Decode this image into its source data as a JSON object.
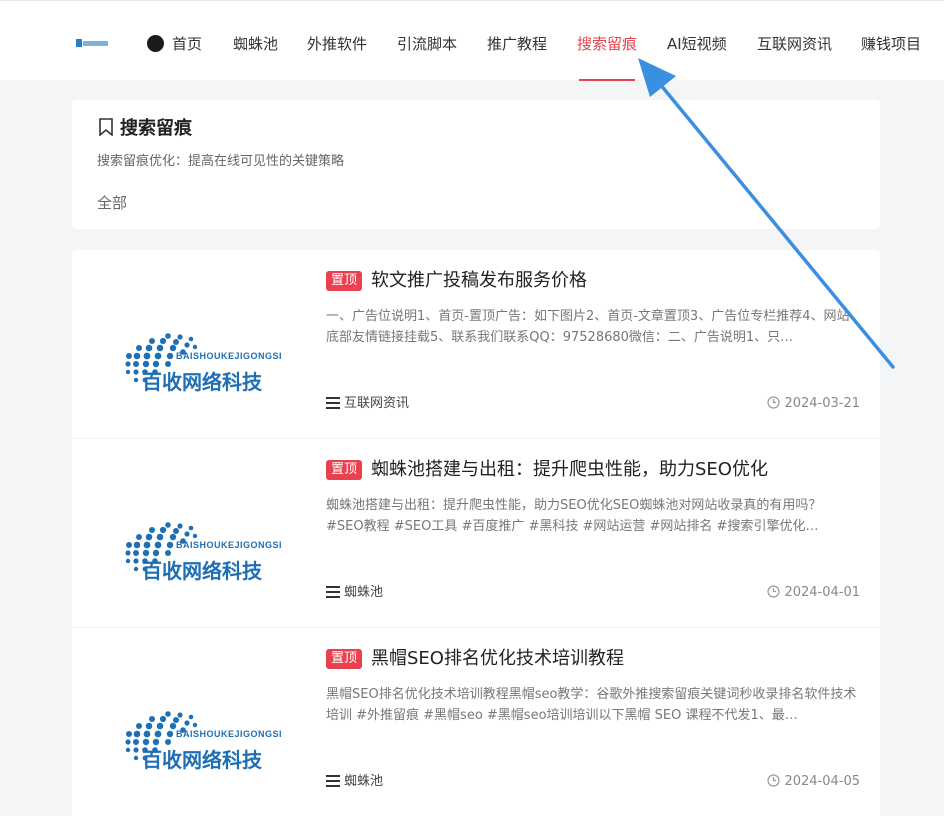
{
  "header": {
    "nav": [
      {
        "label": "首页"
      },
      {
        "label": "蜘蛛池"
      },
      {
        "label": "外推软件"
      },
      {
        "label": "引流脚本"
      },
      {
        "label": "推广教程"
      },
      {
        "label": "搜索留痕"
      },
      {
        "label": "AI短视频"
      },
      {
        "label": "互联网资讯"
      },
      {
        "label": "赚钱项目"
      }
    ],
    "active": "搜索留痕"
  },
  "category": {
    "title": "搜索留痕",
    "description": "搜索留痕优化：提高在线可见性的关键策略",
    "filter_all": "全部"
  },
  "thumbnail": {
    "brand_en": "BAISHOUKEJIGONGSI",
    "brand_cn": "百收网络科技"
  },
  "posts": [
    {
      "badge": "置顶",
      "title": "软文推广投稿发布服务价格",
      "excerpt": "一、广告位说明1、首页-置顶广告：如下图片2、首页-文章置顶3、广告位专栏推荐4、网站底部友情链接挂载5、联系我们联系QQ：97528680微信：二、广告说明1、只…",
      "category": "互联网资讯",
      "date": "2024-03-21"
    },
    {
      "badge": "置顶",
      "title": "蜘蛛池搭建与出租：提升爬虫性能，助力SEO优化",
      "excerpt": "蜘蛛池搭建与出租：提升爬虫性能，助力SEO优化SEO蜘蛛池对网站收录真的有用吗？ #SEO教程 #SEO工具 #百度推广 #黑科技 #网站运营 #网站排名 #搜索引擎优化…",
      "category": "蜘蛛池",
      "date": "2024-04-01"
    },
    {
      "badge": "置顶",
      "title": "黑帽SEO排名优化技术培训教程",
      "excerpt": "黑帽SEO排名优化技术培训教程黑帽seo教学：谷歌外推搜索留痕关键词秒收录排名软件技术培训 #外推留痕 #黑帽seo #黑帽seo培训培训以下黑帽 SEO 课程不代发1、最…",
      "category": "蜘蛛池",
      "date": "2024-04-05"
    }
  ],
  "colors": {
    "accent": "#e8414f",
    "arrow": "#3b8fe0",
    "logo_blue": "#1f6fb5"
  }
}
